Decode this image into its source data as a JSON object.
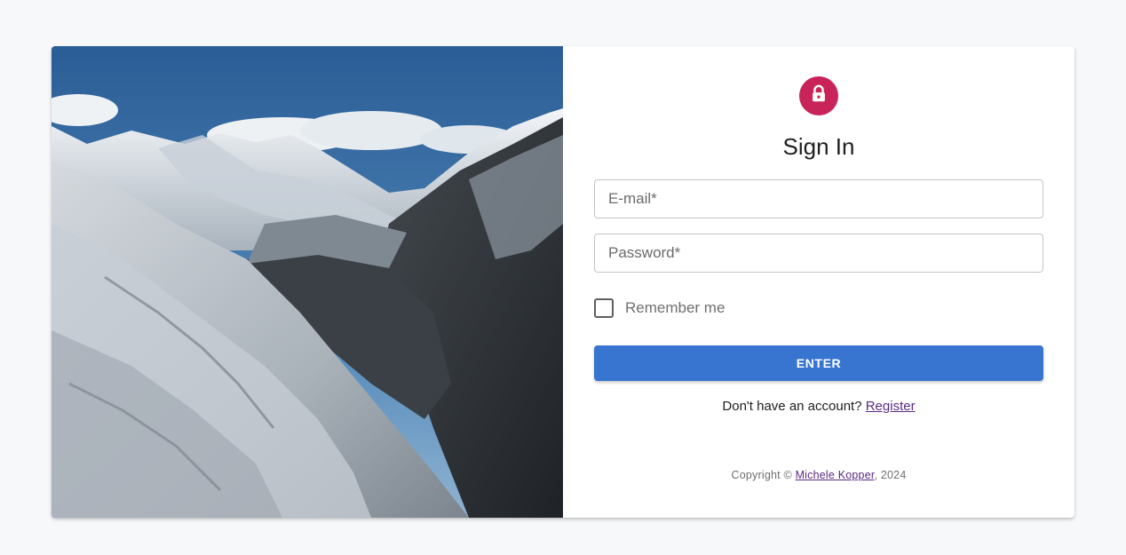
{
  "hero": {
    "image_icon": "mountain-landscape-photo"
  },
  "form": {
    "lock_icon": "lock-icon",
    "title": "Sign In",
    "email_placeholder": "E-mail*",
    "email_value": "",
    "password_placeholder": "Password*",
    "password_value": "",
    "remember_label": "Remember me",
    "remember_checked": false,
    "submit_label": "ENTER",
    "register_prompt": "Don't have an account? ",
    "register_link": "Register"
  },
  "footer": {
    "copyright_prefix": "Copyright © ",
    "author": "Michele Kopper",
    "year_suffix": ", 2024"
  },
  "colors": {
    "accent_blue": "#3875d1",
    "lock_badge": "#c9245a",
    "link": "#5a2a82",
    "page_bg": "#f7f8fa"
  }
}
